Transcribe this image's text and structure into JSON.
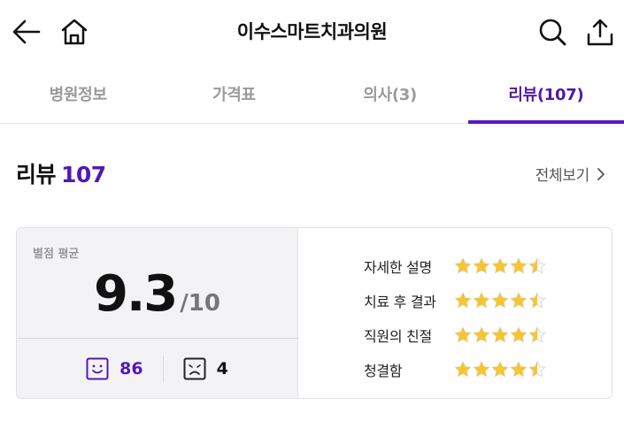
{
  "header": {
    "title": "이수스마트치과의원",
    "icons": [
      "back-arrow-icon",
      "home-icon",
      "search-icon",
      "share-icon"
    ]
  },
  "tabs": [
    {
      "label": "병원정보",
      "active": false
    },
    {
      "label": "가격표",
      "active": false
    },
    {
      "label": "의사(3)",
      "active": false
    },
    {
      "label": "리뷰(107)",
      "active": true
    }
  ],
  "reviews": {
    "title": "리뷰",
    "count": "107",
    "view_all": "전체보기",
    "avg_label": "별점 평균",
    "avg_score": "9.3",
    "avg_max": "/10",
    "good_count": "86",
    "bad_count": "4",
    "criteria": [
      {
        "label": "자세한 설명",
        "rating": 4.5
      },
      {
        "label": "치료 후 결과",
        "rating": 4.5
      },
      {
        "label": "직원의 친절",
        "rating": 4.5
      },
      {
        "label": "청결함",
        "rating": 4.5
      }
    ]
  },
  "colors": {
    "accent": "#5219b5",
    "star": "#f7c531",
    "star_empty": "#d6d6d6"
  }
}
